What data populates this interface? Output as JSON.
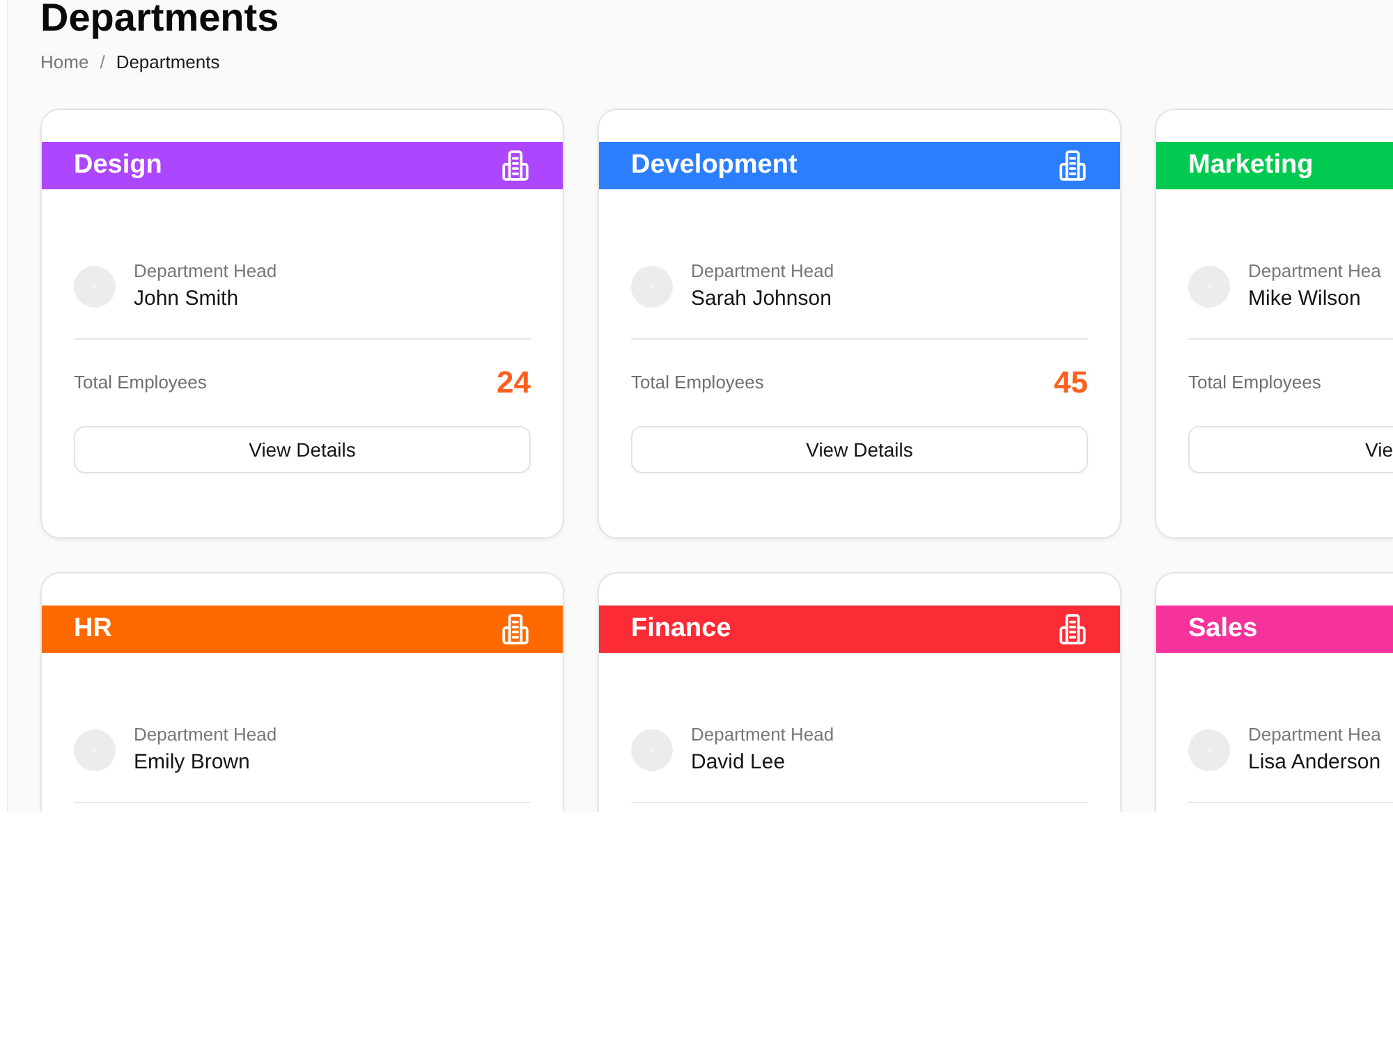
{
  "page": {
    "title": "Departments",
    "breadcrumb": [
      {
        "label": "Home",
        "current": false
      },
      {
        "label": "Departments",
        "current": true
      }
    ],
    "separator": "/"
  },
  "departments": [
    {
      "name": "Design",
      "color": "#ad46ff",
      "head_label": "Department Head",
      "head": "John Smith",
      "total_label": "Total Employees",
      "total": "24",
      "button": "View Details"
    },
    {
      "name": "Development",
      "color": "#2b7fff",
      "head_label": "Department Head",
      "head": "Sarah Johnson",
      "total_label": "Total Employees",
      "total": "45",
      "button": "View Details"
    },
    {
      "name": "Marketing",
      "color": "#00c950",
      "head_label": "Department Hea",
      "head": "Mike Wilson",
      "total_label": "Total Employees",
      "button": "Vie"
    },
    {
      "name": "HR",
      "color": "#ff6900",
      "head_label": "Department Head",
      "head": "Emily Brown"
    },
    {
      "name": "Finance",
      "color": "#fb2c36",
      "head_label": "Department Head",
      "head": "David Lee"
    },
    {
      "name": "Sales",
      "color": "#f6339a",
      "head_label": "Department Hea",
      "head": "Lisa Anderson"
    }
  ]
}
